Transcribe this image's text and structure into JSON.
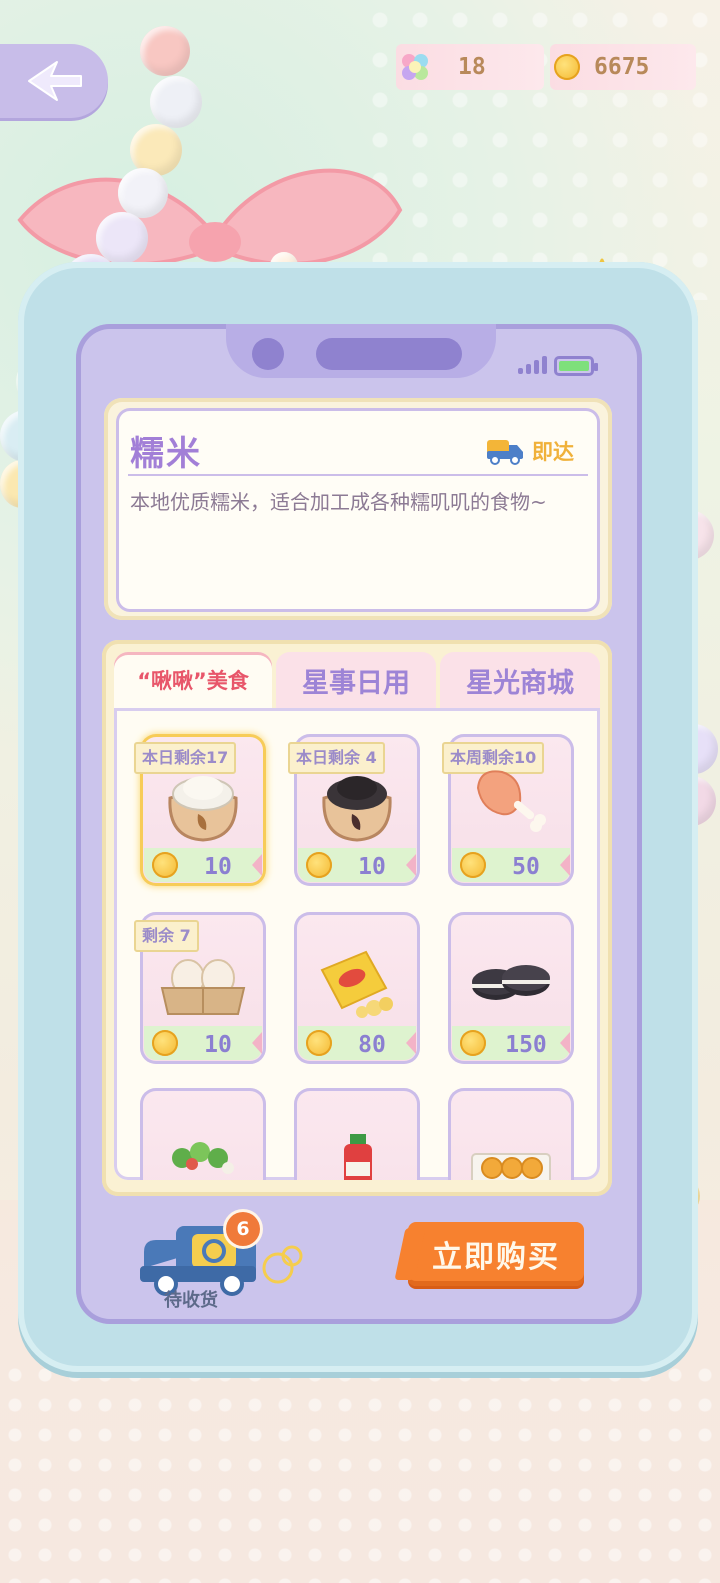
{
  "header": {
    "star_currency": "18",
    "coin_currency": "6675"
  },
  "item": {
    "name": "糯米",
    "delivery_label": "即达",
    "description": "本地优质糯米，适合加工成各种糯叽叽的食物~"
  },
  "tabs": [
    {
      "label": "“啾啾”美食",
      "active": true
    },
    {
      "label": "星事日用",
      "active": false
    },
    {
      "label": "星光商城",
      "active": false
    }
  ],
  "products": [
    {
      "icon": "rice-sack-icon",
      "badge": "本日剩余17",
      "price": "10",
      "selected": true
    },
    {
      "icon": "black-rice-sack-icon",
      "badge": "本日剩余 4",
      "price": "10",
      "selected": false
    },
    {
      "icon": "chicken-leg-icon",
      "badge": "本周剩余10",
      "price": "50",
      "selected": false
    },
    {
      "icon": "eggs-icon",
      "badge": "剩余 7",
      "price": "10",
      "selected": false
    },
    {
      "icon": "chips-bag-icon",
      "badge": "",
      "price": "80",
      "selected": false
    },
    {
      "icon": "cookies-icon",
      "badge": "",
      "price": "150",
      "selected": false
    },
    {
      "icon": "salad-icon",
      "badge": "",
      "price": "",
      "selected": false
    },
    {
      "icon": "juice-bottle-icon",
      "badge": "",
      "price": "",
      "selected": false
    },
    {
      "icon": "egg-tarts-icon",
      "badge": "",
      "price": "",
      "selected": false
    }
  ],
  "bottom": {
    "pending_label": "待收货",
    "pending_count": "6",
    "buy_label": "立即购买"
  },
  "colors": {
    "accent_purple": "#a27fd7",
    "active_tab_red": "#e8566a",
    "buy_orange": "#f7812f",
    "coin_gold": "#f3b52b"
  }
}
